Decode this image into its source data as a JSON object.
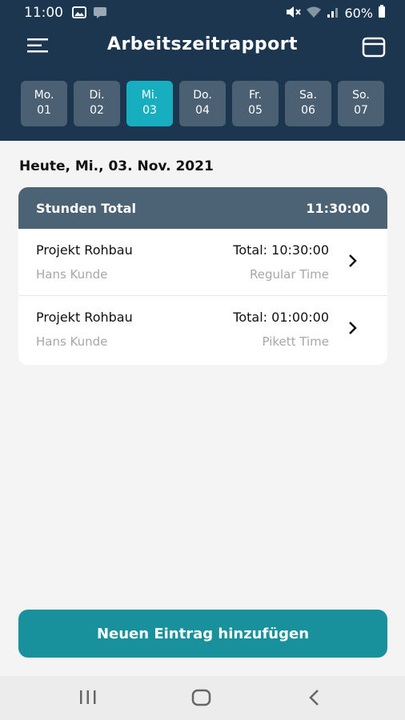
{
  "status": {
    "time": "11:00",
    "battery": "60%"
  },
  "header": {
    "title": "Arbeitszeitrapport"
  },
  "days": [
    {
      "name": "Mo.",
      "num": "01",
      "active": false
    },
    {
      "name": "Di.",
      "num": "02",
      "active": false
    },
    {
      "name": "Mi.",
      "num": "03",
      "active": true
    },
    {
      "name": "Do.",
      "num": "04",
      "active": false
    },
    {
      "name": "Fr.",
      "num": "05",
      "active": false
    },
    {
      "name": "Sa.",
      "num": "06",
      "active": false
    },
    {
      "name": "So.",
      "num": "07",
      "active": false
    }
  ],
  "date_heading": "Heute, Mi., 03. Nov. 2021",
  "summary": {
    "label": "Stunden Total",
    "value": "11:30:00"
  },
  "entries": [
    {
      "project": "Projekt Rohbau",
      "total": "Total: 10:30:00",
      "client": "Hans Kunde",
      "type": "Regular Time"
    },
    {
      "project": "Projekt Rohbau",
      "total": "Total: 01:00:00",
      "client": "Hans Kunde",
      "type": "Pikett Time"
    }
  ],
  "add_button": "Neuen Eintrag hinzufügen",
  "colors": {
    "header_bg": "#1c3650",
    "active_day": "#17aebf",
    "day_bg": "#4b6072",
    "button": "#18919c",
    "card_head": "#4c6275"
  },
  "icons": [
    "image-icon",
    "message-icon",
    "mute-icon",
    "wifi-icon",
    "signal-icon",
    "battery-icon",
    "menu-icon",
    "calendar-icon",
    "chevron-right-icon",
    "recent-apps-icon",
    "home-icon",
    "back-icon"
  ]
}
